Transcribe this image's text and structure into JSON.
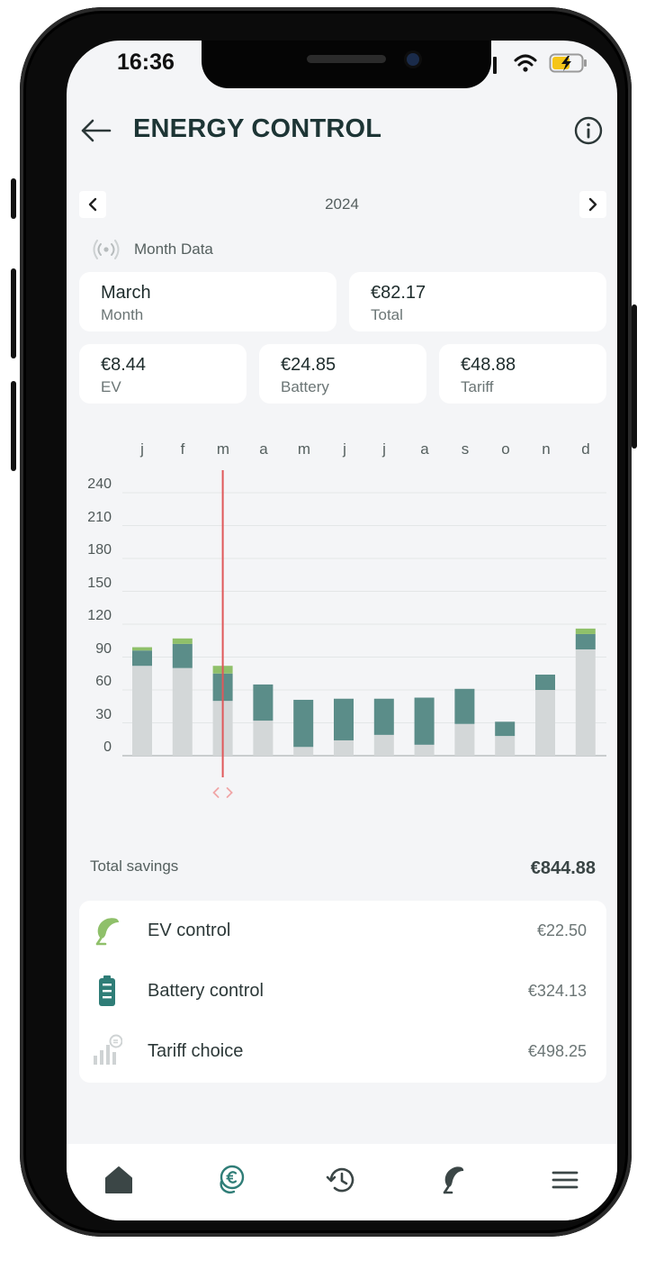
{
  "status_bar": {
    "time": "16:36"
  },
  "header": {
    "title": "ENERGY CONTROL"
  },
  "year_nav": {
    "year": "2024"
  },
  "section": {
    "label": "Month Data"
  },
  "summary": {
    "month_value": "March",
    "month_label": "Month",
    "total_value": "€82.17",
    "total_label": "Total",
    "ev_value": "€8.44",
    "ev_label": "EV",
    "battery_value": "€24.85",
    "battery_label": "Battery",
    "tariff_value": "€48.88",
    "tariff_label": "Tariff"
  },
  "chart_data": {
    "type": "bar",
    "stacked": true,
    "categories": [
      "j",
      "f",
      "m",
      "a",
      "m",
      "j",
      "j",
      "a",
      "s",
      "o",
      "n",
      "d"
    ],
    "series": [
      {
        "values": [
          82,
          80,
          50,
          32,
          8,
          14,
          19,
          10,
          29,
          18,
          60,
          97
        ],
        "color": "#d3d7d8"
      },
      {
        "values": [
          14,
          22,
          25,
          33,
          43,
          38,
          33,
          43,
          32,
          13,
          14,
          14
        ],
        "color": "#5b8d89"
      },
      {
        "values": [
          3,
          5,
          7,
          0,
          0,
          0,
          0,
          0,
          0,
          0,
          0,
          5
        ],
        "color": "#8fc06a"
      }
    ],
    "yticks": [
      0,
      30,
      60,
      90,
      120,
      150,
      180,
      210,
      240
    ],
    "ylim": [
      0,
      260
    ],
    "selected_index": 2,
    "grid": true
  },
  "savings": {
    "total_label": "Total savings",
    "total_value": "€844.88",
    "items": [
      {
        "label": "EV control",
        "value": "€22.50",
        "icon": "ev-plug-icon"
      },
      {
        "label": "Battery control",
        "value": "€324.13",
        "icon": "battery-icon"
      },
      {
        "label": "Tariff choice",
        "value": "€498.25",
        "icon": "tariff-euro-icon"
      }
    ]
  },
  "colors": {
    "accent": "#2f7d77",
    "selected_line": "#e0585a",
    "ev_green": "#8fc06a"
  }
}
